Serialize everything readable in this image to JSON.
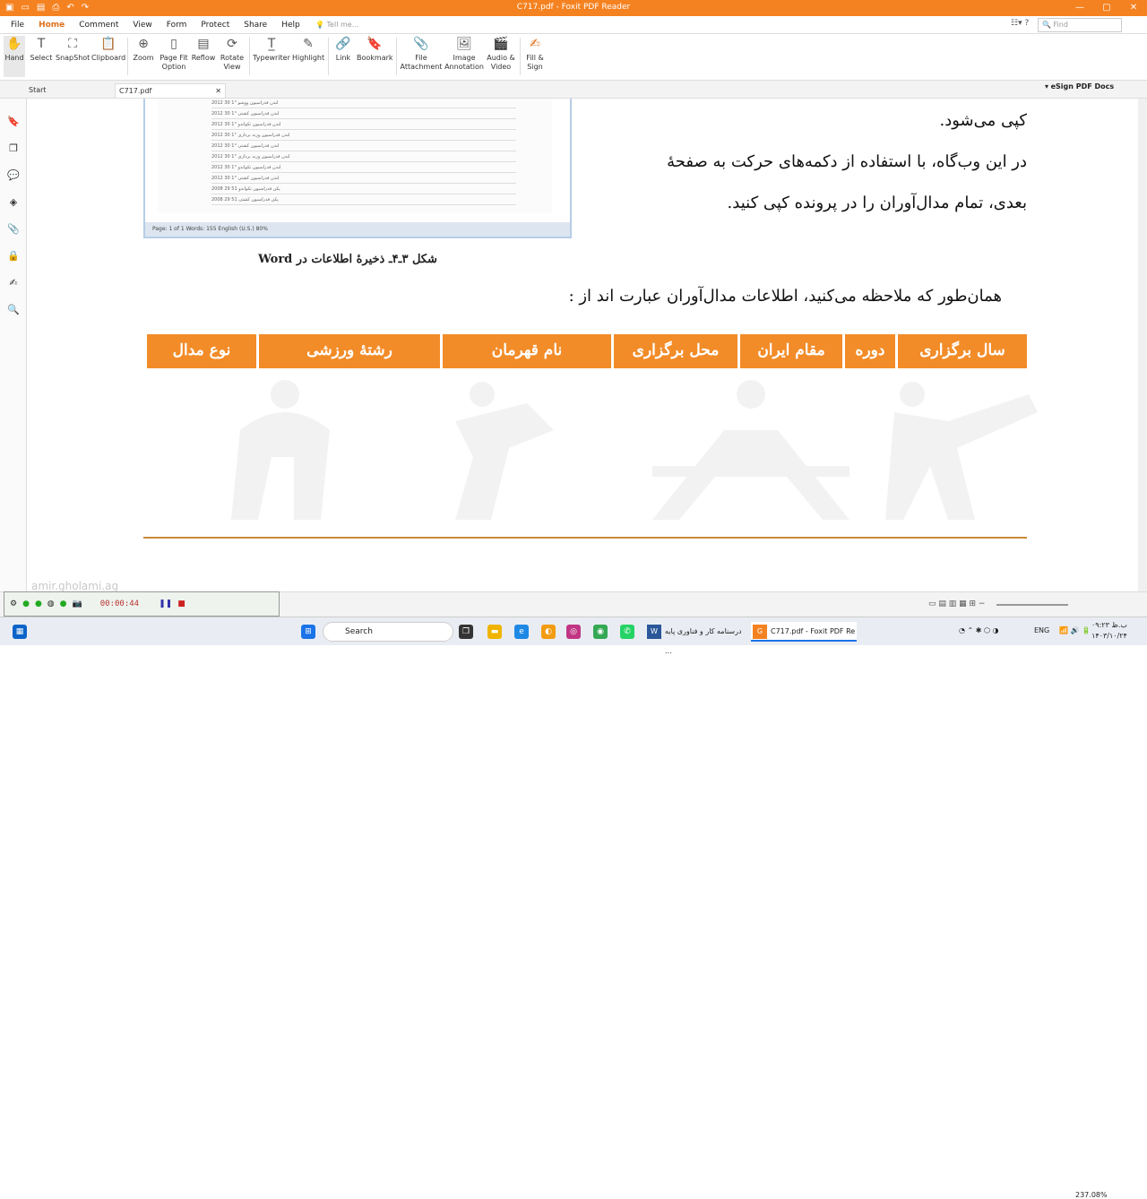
{
  "window": {
    "title": "C717.pdf - Foxit PDF Reader"
  },
  "menu": {
    "items": [
      "File",
      "Home",
      "Comment",
      "View",
      "Form",
      "Protect",
      "Share",
      "Help"
    ],
    "active": "Home",
    "tellme": "Tell me...",
    "find": "Find"
  },
  "ribbon": {
    "tools": [
      {
        "label": "Hand",
        "icon": "hand-icon"
      },
      {
        "label": "Select",
        "icon": "select-icon"
      },
      {
        "label": "SnapShot",
        "icon": "snapshot-icon"
      },
      {
        "label": "Clipboard",
        "icon": "clipboard-icon"
      },
      {
        "label": "Zoom",
        "icon": "zoom-icon"
      },
      {
        "label": "Page Fit Option",
        "icon": "page-fit-icon"
      },
      {
        "label": "Reflow",
        "icon": "reflow-icon"
      },
      {
        "label": "Rotate View",
        "icon": "rotate-icon"
      },
      {
        "label": "Typewriter",
        "icon": "typewriter-icon"
      },
      {
        "label": "Highlight",
        "icon": "highlight-icon"
      },
      {
        "label": "Link",
        "icon": "link-icon"
      },
      {
        "label": "Bookmark",
        "icon": "bookmark-icon"
      },
      {
        "label": "File Attachment",
        "icon": "attachment-icon"
      },
      {
        "label": "Image Annotation",
        "icon": "image-icon"
      },
      {
        "label": "Audio & Video",
        "icon": "video-icon"
      },
      {
        "label": "Fill & Sign",
        "icon": "sign-icon"
      }
    ]
  },
  "tabs": {
    "start": "Start",
    "doc": "C717.pdf",
    "esign": "eSign PDF Docs"
  },
  "document": {
    "para1_line1": "کپی می‌شود.",
    "para2_line1": "در این وب‌گاه، با استفاده از دکمه‌های حرکت به صفحهٔ",
    "para2_line2": "بعدی، تمام مدال‌آوران را در پرونده کپی کنید.",
    "caption": "شکل ۳ـ۴ـ ذخیرهٔ اطلاعات در Word",
    "para3": "همان‌طور که ملاحظه می‌کنید، اطلاعات مدال‌آوران عبارت اند از :",
    "table_headers": [
      "سال برگزاری",
      "دوره",
      "مقام ایران",
      "محل برگزاری",
      "نام قهرمان",
      "رشتهٔ ورزشی",
      "نوع مدال"
    ],
    "screenshot_status": "Page: 1 of 1   Words: 155   English (U.S.)   80%",
    "screenshot_rows": [
      "2012   30   1°   لندن   فدراسیون ووشو",
      "2012   30   1°   لندن   فدراسیون کشتی",
      "2012   30   1°   لندن   فدراسیون تکواندو",
      "2012   30   1°   لندن   فدراسیون وزنه برداری",
      "2012   30   1°   لندن   فدراسیون کشتی",
      "2012   30   1°   لندن   فدراسیون وزنه برداری",
      "2012   30   1°   لندن   فدراسیون تکواندو",
      "2012   30   1°   لندن   فدراسیون کشتی",
      "2008   29   51   پکن   فدراسیون تکواندو",
      "2008   29   51   پکن   فدراسیون کشتی"
    ]
  },
  "recorder": {
    "time": "00:00:44",
    "watermark": "amir.gholami.ag"
  },
  "status": {
    "zoom": "237.08%"
  },
  "taskbar": {
    "search": "Search",
    "app1": "درسنامه کار و فناوری پایه ...",
    "app2": "C717.pdf - Foxit PDF Re",
    "lang": "ENG",
    "time": "۰۹:۲۳ ب.ظ",
    "date": "۱۴۰۳/۱۰/۲۴"
  }
}
